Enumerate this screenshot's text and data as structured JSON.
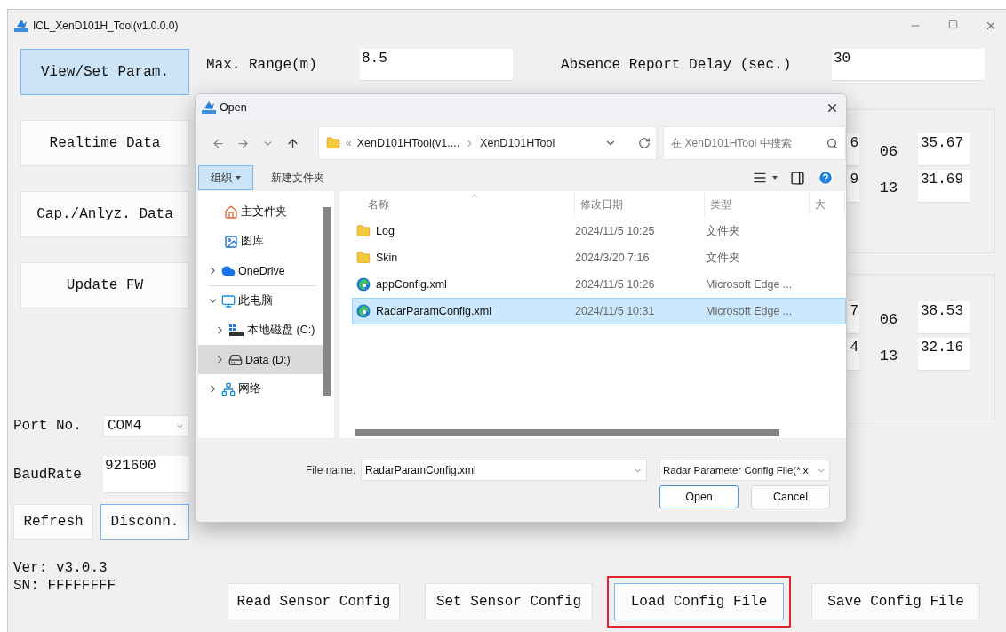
{
  "window": {
    "title": "ICL_XenD101H_Tool(v1.0.0.0)"
  },
  "nav_buttons": [
    {
      "label": "View/Set Param.",
      "selected": true
    },
    {
      "label": "Realtime Data",
      "selected": false
    },
    {
      "label": "Cap./Anlyz. Data",
      "selected": false
    },
    {
      "label": "Update FW",
      "selected": false
    }
  ],
  "params": [
    {
      "label": "Max. Range(m)",
      "value": "8.5"
    },
    {
      "label": "Absence Report Delay (sec.)",
      "value": "30"
    }
  ],
  "panels": [
    {
      "rows": [
        {
          "partial_value": "6",
          "label": "06",
          "value": "35.67"
        },
        {
          "partial_value": "9",
          "label": "13",
          "value": "31.69"
        }
      ]
    },
    {
      "rows": [
        {
          "partial_value": "7",
          "label": "06",
          "value": "38.53"
        },
        {
          "partial_value": "4",
          "label": "13",
          "value": "32.16"
        }
      ]
    }
  ],
  "connection": {
    "port_label": "Port No.",
    "port_value": "COM4",
    "baud_label": "BaudRate",
    "baud_value": "921600",
    "buttons": [
      {
        "label": "Refresh",
        "focused": false
      },
      {
        "label": "Disconn.",
        "focused": true
      }
    ],
    "version": "Ver: v3.0.3",
    "serial": "SN: FFFFFFFF"
  },
  "actions": [
    {
      "label": "Read Sensor Config",
      "focused": false,
      "highlighted": false
    },
    {
      "label": "Set Sensor Config",
      "focused": false,
      "highlighted": false
    },
    {
      "label": "Load Config File",
      "focused": true,
      "highlighted": true
    },
    {
      "label": "Save Config File",
      "focused": false,
      "highlighted": false
    }
  ],
  "dialog": {
    "title": "Open",
    "breadcrumb": {
      "overflow": "«",
      "parts": [
        "XenD101HTool(v1....",
        "XenD101HTool"
      ]
    },
    "search": {
      "placeholder": "在 XenD101HTool 中搜索"
    },
    "toolbar": {
      "organize": "组织",
      "new_folder": "新建文件夹"
    },
    "nav_pane": {
      "quick_access": [
        {
          "label": "主文件夹",
          "kind": "home",
          "selected": false
        },
        {
          "label": "图库",
          "kind": "gallery",
          "selected": false
        },
        {
          "label": "OneDrive",
          "kind": "cloud",
          "expanded": false,
          "selected": false
        }
      ],
      "tree": [
        {
          "label": "此电脑",
          "kind": "computer",
          "expanded": true,
          "selected": false,
          "children": [
            {
              "label": "本地磁盘 (C:)",
              "kind": "system-drive",
              "expanded": false,
              "selected": false
            },
            {
              "label": "Data (D:)",
              "kind": "drive",
              "expanded": false,
              "selected": true
            }
          ]
        },
        {
          "label": "网络",
          "kind": "network",
          "expanded": false,
          "selected": false
        }
      ]
    },
    "columns": [
      "名称",
      "修改日期",
      "类型",
      "大"
    ],
    "files": [
      {
        "name": "Log",
        "kind": "folder",
        "modified": "2024/11/5 10:25",
        "type": "文件夹",
        "selected": false
      },
      {
        "name": "Skin",
        "kind": "folder",
        "modified": "2024/3/20 7:16",
        "type": "文件夹",
        "selected": false
      },
      {
        "name": "appConfig.xml",
        "kind": "edge-file",
        "modified": "2024/11/5 10:26",
        "type": "Microsoft Edge ...",
        "selected": false
      },
      {
        "name": "RadarParamConfig.xml",
        "kind": "edge-file",
        "modified": "2024/11/5 10:31",
        "type": "Microsoft Edge ...",
        "selected": true
      }
    ],
    "file_name": {
      "label": "File name:",
      "value": "RadarParamConfig.xml"
    },
    "filter": {
      "value": "Radar Parameter Config File(*.x"
    },
    "buttons": [
      {
        "label": "Open",
        "default": true
      },
      {
        "label": "Cancel",
        "default": false
      }
    ]
  }
}
